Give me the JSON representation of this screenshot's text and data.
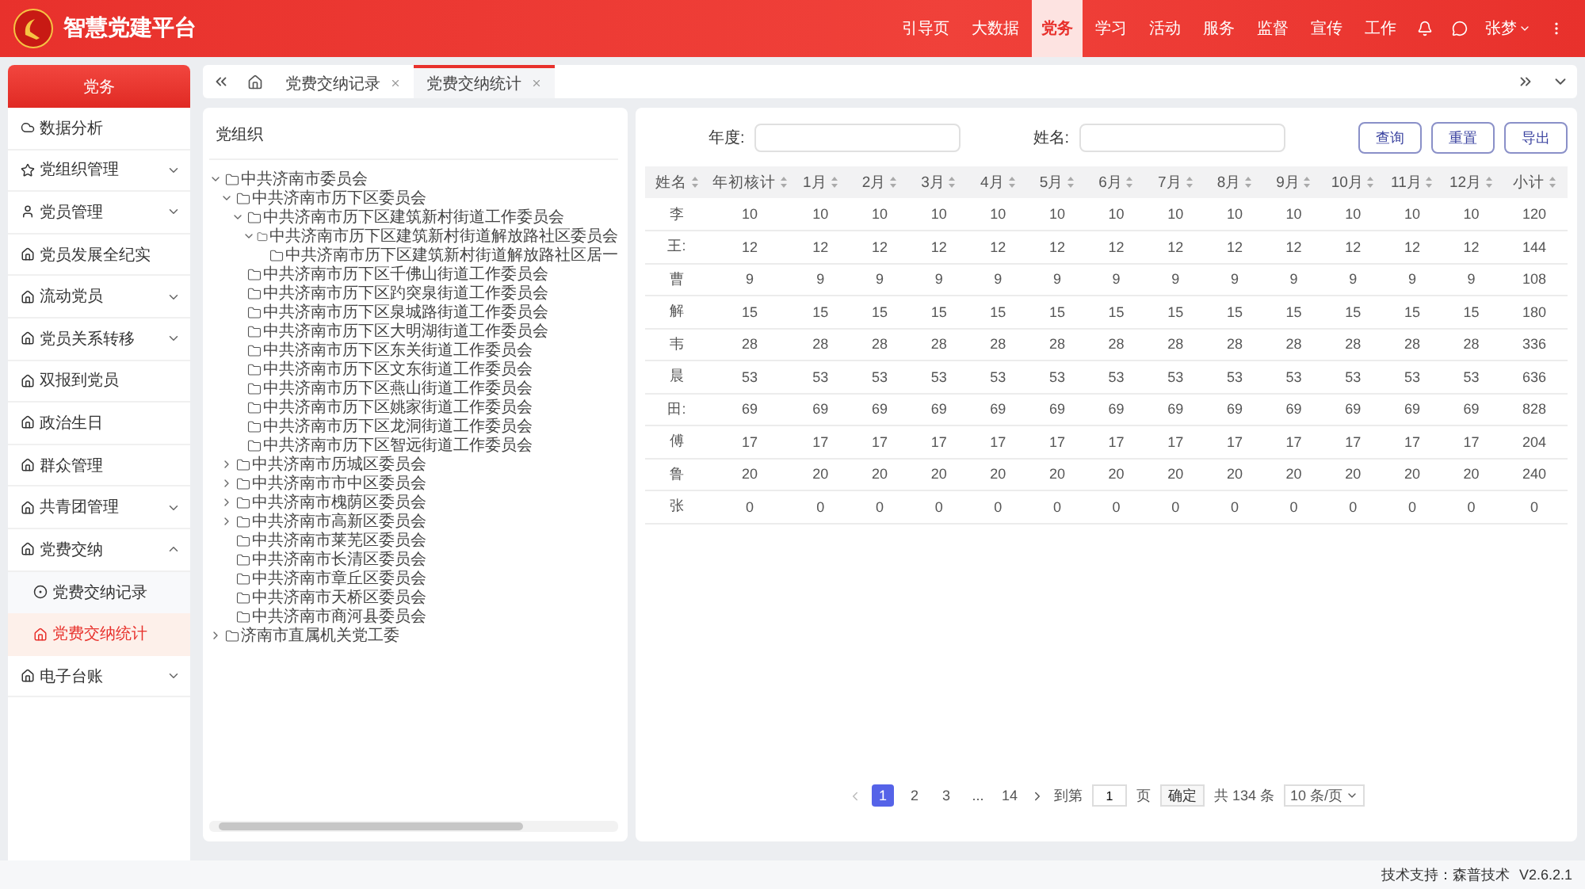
{
  "header": {
    "title": "智慧党建平台",
    "user": "张梦",
    "nav": [
      {
        "label": "引导页",
        "selected": false
      },
      {
        "label": "大数据",
        "selected": false
      },
      {
        "label": "党务",
        "selected": true
      },
      {
        "label": "学习",
        "selected": false
      },
      {
        "label": "活动",
        "selected": false
      },
      {
        "label": "服务",
        "selected": false
      },
      {
        "label": "监督",
        "selected": false
      },
      {
        "label": "宣传",
        "selected": false
      },
      {
        "label": "工作",
        "selected": false
      }
    ]
  },
  "sidebar": {
    "title": "党务",
    "items": [
      {
        "label": "数据分析",
        "kind": "link",
        "selected": false
      },
      {
        "label": "党组织管理",
        "kind": "group",
        "expanded": false,
        "selected": false
      },
      {
        "label": "党员管理",
        "kind": "group",
        "expanded": false,
        "selected": false
      },
      {
        "label": "党员发展全纪实",
        "kind": "link",
        "selected": false
      },
      {
        "label": "流动党员",
        "kind": "group",
        "expanded": false,
        "selected": false
      },
      {
        "label": "党员关系转移",
        "kind": "group",
        "expanded": false,
        "selected": false
      },
      {
        "label": "双报到党员",
        "kind": "link",
        "selected": false
      },
      {
        "label": "政治生日",
        "kind": "link",
        "selected": false
      },
      {
        "label": "群众管理",
        "kind": "link",
        "selected": false
      },
      {
        "label": "共青团管理",
        "kind": "group",
        "expanded": false,
        "selected": false
      },
      {
        "label": "党费交纳",
        "kind": "group",
        "expanded": true,
        "selected": false,
        "children": [
          {
            "label": "党费交纳记录",
            "selected": false
          },
          {
            "label": "党费交纳统计",
            "selected": true
          }
        ]
      },
      {
        "label": "电子台账",
        "kind": "group",
        "expanded": false,
        "selected": false
      }
    ]
  },
  "tabs": [
    {
      "label": "党费交纳记录",
      "selected": false
    },
    {
      "label": "党费交纳统计",
      "selected": true
    }
  ],
  "tree": {
    "title": "党组织",
    "nodes": [
      {
        "label": "中共济南市委员会",
        "expanded": true,
        "children": [
          {
            "label": "中共济南市历下区委员会",
            "expanded": true,
            "children": [
              {
                "label": "中共济南市历下区建筑新村街道工作委员会",
                "expanded": true,
                "children": [
                  {
                    "label": "中共济南市历下区建筑新村街道解放路社区委员会",
                    "expanded": true,
                    "children": [
                      {
                        "label": "中共济南市历下区建筑新村街道解放路社区居一"
                      }
                    ]
                  }
                ]
              },
              {
                "label": "中共济南市历下区千佛山街道工作委员会"
              },
              {
                "label": "中共济南市历下区趵突泉街道工作委员会"
              },
              {
                "label": "中共济南市历下区泉城路街道工作委员会"
              },
              {
                "label": "中共济南市历下区大明湖街道工作委员会"
              },
              {
                "label": "中共济南市历下区东关街道工作委员会"
              },
              {
                "label": "中共济南市历下区文东街道工作委员会"
              },
              {
                "label": "中共济南市历下区燕山街道工作委员会"
              },
              {
                "label": "中共济南市历下区姚家街道工作委员会"
              },
              {
                "label": "中共济南市历下区龙洞街道工作委员会"
              },
              {
                "label": "中共济南市历下区智远街道工作委员会"
              }
            ]
          },
          {
            "label": "中共济南市历城区委员会",
            "expanded": false
          },
          {
            "label": "中共济南市市中区委员会",
            "expanded": false
          },
          {
            "label": "中共济南市槐荫区委员会",
            "expanded": false
          },
          {
            "label": "中共济南市高新区委员会",
            "expanded": false
          },
          {
            "label": "中共济南市莱芜区委员会"
          },
          {
            "label": "中共济南市长清区委员会"
          },
          {
            "label": "中共济南市章丘区委员会"
          },
          {
            "label": "中共济南市天桥区委员会"
          },
          {
            "label": "中共济南市商河县委员会"
          }
        ]
      },
      {
        "label": "济南市直属机关党工委",
        "expanded": false
      }
    ]
  },
  "filters": [
    {
      "label": "年度:"
    },
    {
      "label": "姓名:"
    }
  ],
  "buttons": [
    "查询",
    "重置",
    "导出"
  ],
  "table": {
    "columns": [
      "姓名",
      "年初核计",
      "1月",
      "2月",
      "3月",
      "4月",
      "5月",
      "6月",
      "7月",
      "8月",
      "9月",
      "10月",
      "11月",
      "12月",
      "小计"
    ],
    "rows": [
      [
        "李",
        "10",
        "10",
        "10",
        "10",
        "10",
        "10",
        "10",
        "10",
        "10",
        "10",
        "10",
        "10",
        "10",
        "120"
      ],
      [
        "王:",
        "12",
        "12",
        "12",
        "12",
        "12",
        "12",
        "12",
        "12",
        "12",
        "12",
        "12",
        "12",
        "12",
        "144"
      ],
      [
        "曹",
        "9",
        "9",
        "9",
        "9",
        "9",
        "9",
        "9",
        "9",
        "9",
        "9",
        "9",
        "9",
        "9",
        "108"
      ],
      [
        "解",
        "15",
        "15",
        "15",
        "15",
        "15",
        "15",
        "15",
        "15",
        "15",
        "15",
        "15",
        "15",
        "15",
        "180"
      ],
      [
        "韦",
        "28",
        "28",
        "28",
        "28",
        "28",
        "28",
        "28",
        "28",
        "28",
        "28",
        "28",
        "28",
        "28",
        "336"
      ],
      [
        "晨",
        "53",
        "53",
        "53",
        "53",
        "53",
        "53",
        "53",
        "53",
        "53",
        "53",
        "53",
        "53",
        "53",
        "636"
      ],
      [
        "田:",
        "69",
        "69",
        "69",
        "69",
        "69",
        "69",
        "69",
        "69",
        "69",
        "69",
        "69",
        "69",
        "69",
        "828"
      ],
      [
        "傅",
        "17",
        "17",
        "17",
        "17",
        "17",
        "17",
        "17",
        "17",
        "17",
        "17",
        "17",
        "17",
        "17",
        "204"
      ],
      [
        "鲁",
        "20",
        "20",
        "20",
        "20",
        "20",
        "20",
        "20",
        "20",
        "20",
        "20",
        "20",
        "20",
        "20",
        "240"
      ],
      [
        "张",
        "0",
        "0",
        "0",
        "0",
        "0",
        "0",
        "0",
        "0",
        "0",
        "0",
        "0",
        "0",
        "0",
        "0"
      ]
    ]
  },
  "pagination": {
    "pages": [
      {
        "label": "1",
        "selected": true
      },
      {
        "label": "2",
        "selected": false
      },
      {
        "label": "3",
        "selected": false
      },
      {
        "label": "...",
        "selected": false
      },
      {
        "label": "14",
        "selected": false
      }
    ],
    "goto_label": "到第",
    "goto_value": "1",
    "page_unit": "页",
    "confirm": "确定",
    "total": "共 134 条",
    "page_size": "10 条/页"
  },
  "footer": {
    "support": "技术支持：森普技术",
    "version": "V2.6.2.1"
  }
}
